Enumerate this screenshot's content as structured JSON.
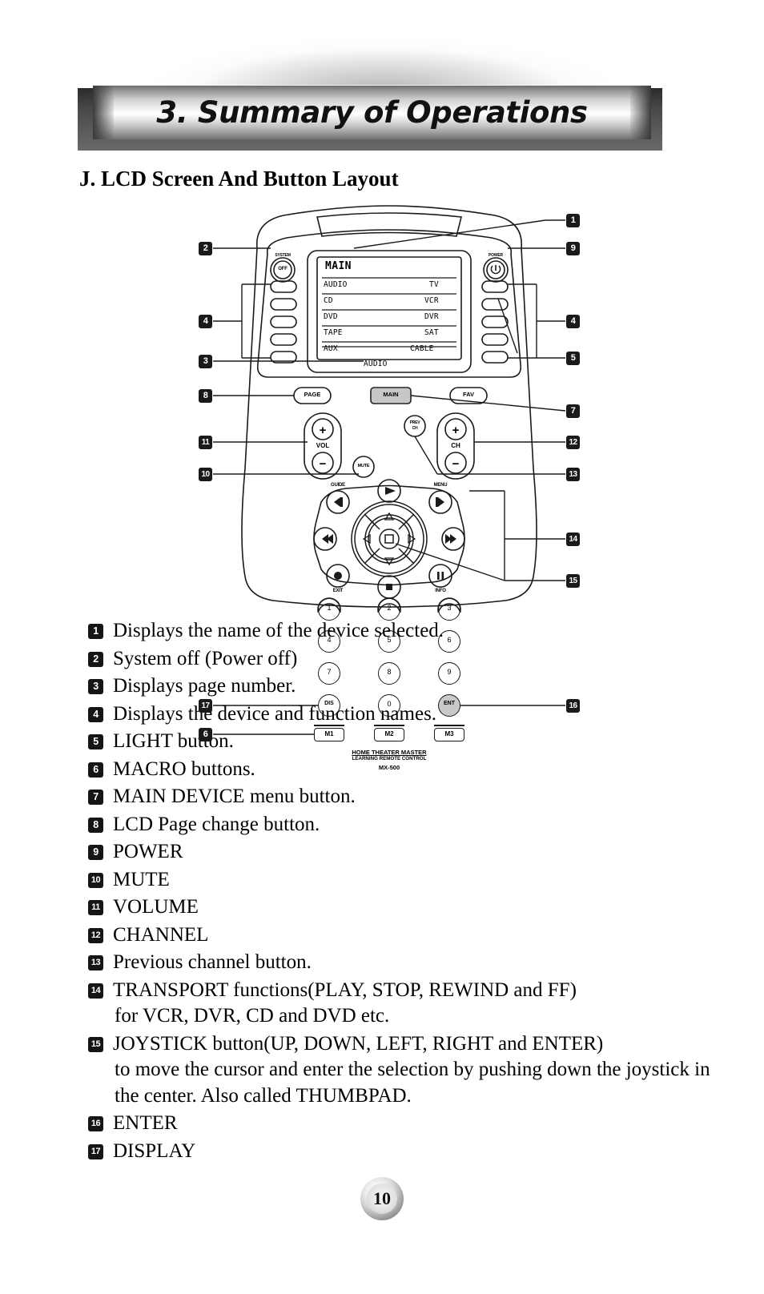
{
  "header": {
    "chapter_title": "3. Summary of Operations"
  },
  "section": {
    "heading": "J. LCD Screen And Button Layout"
  },
  "diagram": {
    "device_model": "MX-500",
    "brand_line1": "HOME THEATER MASTER",
    "brand_line2": "LEARNING REMOTE CONTROL",
    "lcd": {
      "title": "MAIN",
      "rows": [
        {
          "left": "AUDIO",
          "right": "TV"
        },
        {
          "left": "CD",
          "right": "VCR"
        },
        {
          "left": "DVD",
          "right": "DVR"
        },
        {
          "left": "TAPE",
          "right": "SAT"
        },
        {
          "left": "AUX",
          "right": "CABLE"
        }
      ],
      "footer": "AUDIO"
    },
    "labels": {
      "system": "SYSTEM",
      "off": "OFF",
      "power": "POWER",
      "page": "PAGE",
      "main": "MAIN",
      "fav": "FAV",
      "vol": "VOL",
      "ch": "CH",
      "mute": "MUTE",
      "prev_ch_line1": "PREV",
      "prev_ch_line2": "CH",
      "guide": "GUIDE",
      "menu": "MENU",
      "exit": "EXIT",
      "info": "INFO",
      "dis": "DIS",
      "ent": "ENT",
      "plus": "+",
      "minus": "−",
      "macro1": "M1",
      "macro2": "M2",
      "macro3": "M3"
    },
    "keypad": [
      "1",
      "2",
      "3",
      "4",
      "5",
      "6",
      "7",
      "8",
      "9",
      "0"
    ],
    "callouts": [
      "1",
      "2",
      "3",
      "4",
      "4",
      "5",
      "6",
      "7",
      "8",
      "9",
      "10",
      "11",
      "12",
      "13",
      "14",
      "15",
      "16",
      "17"
    ]
  },
  "legend": {
    "items": [
      {
        "num": "1",
        "text": "Displays the name of the device selected.",
        "cont": ""
      },
      {
        "num": "2",
        "text": "System off (Power off)",
        "cont": ""
      },
      {
        "num": "3",
        "text": "Displays page number.",
        "cont": ""
      },
      {
        "num": "4",
        "text": "Displays the device and function names.",
        "cont": ""
      },
      {
        "num": "5",
        "text": "LIGHT button.",
        "cont": ""
      },
      {
        "num": "6",
        "text": "MACRO buttons.",
        "cont": ""
      },
      {
        "num": "7",
        "text": "MAIN DEVICE menu button.",
        "cont": ""
      },
      {
        "num": "8",
        "text": "LCD Page change button.",
        "cont": ""
      },
      {
        "num": "9",
        "text": "POWER",
        "cont": ""
      },
      {
        "num": "10",
        "text": "MUTE",
        "cont": ""
      },
      {
        "num": "11",
        "text": "VOLUME",
        "cont": ""
      },
      {
        "num": "12",
        "text": "CHANNEL",
        "cont": ""
      },
      {
        "num": "13",
        "text": "Previous channel button.",
        "cont": ""
      },
      {
        "num": "14",
        "text": "TRANSPORT functions(PLAY, STOP, REWIND and FF)",
        "cont": "for VCR, DVR, CD and DVD etc."
      },
      {
        "num": "15",
        "text": "JOYSTICK button(UP, DOWN, LEFT, RIGHT and ENTER)",
        "cont": "to move the cursor and enter the selection by pushing down the joystick in the center. Also called THUMBPAD."
      },
      {
        "num": "16",
        "text": "ENTER",
        "cont": ""
      },
      {
        "num": "17",
        "text": "DISPLAY",
        "cont": ""
      }
    ]
  },
  "footer": {
    "page_number": "10"
  }
}
